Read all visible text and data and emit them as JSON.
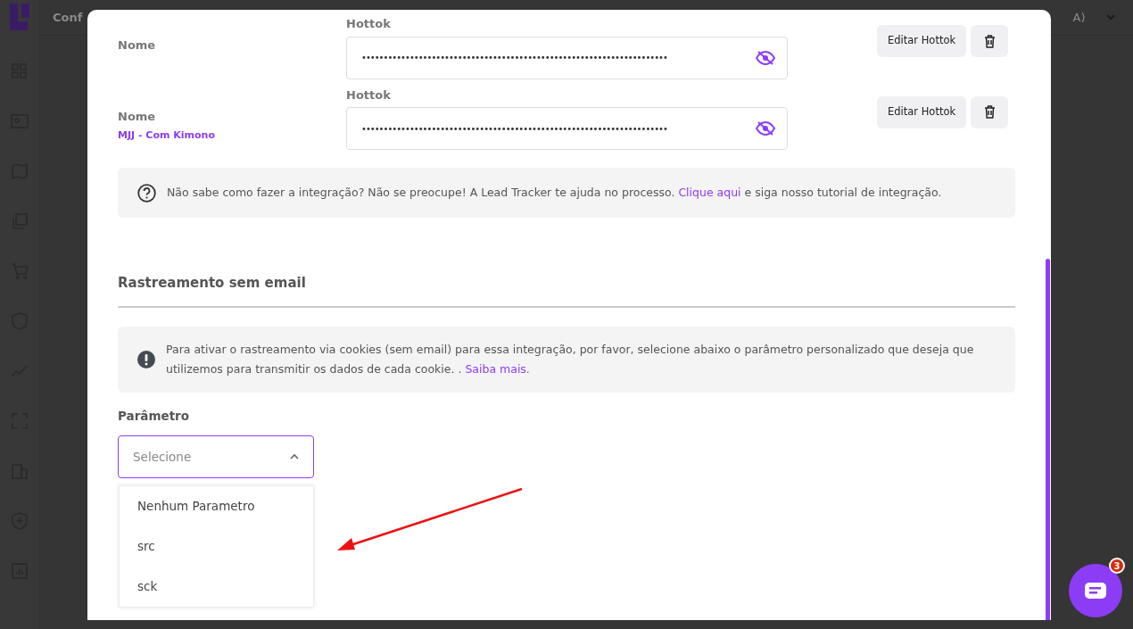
{
  "background": {
    "title": "Conf",
    "account": "A)"
  },
  "hottoks": [
    {
      "name_label": "Nome",
      "field_label": "Hottok",
      "value": "••••••••••••••••••••••••••••••••••••••••••••••••••••••••••••••••••••••",
      "edit_button": "Editar Hottok"
    },
    {
      "name_label": "Nome",
      "name_value": "MJJ - Com Kimono",
      "field_label": "Hottok",
      "value": "••••••••••••••••••••••••••••••••••••••••••••••••••••••••••••••••••••••",
      "edit_button": "Editar Hottok"
    }
  ],
  "help_note": {
    "text": "Não sabe como fazer a integração? Não se preocupe! A Lead Tracker te ajuda no processo. ",
    "link": "Clique aqui",
    "after": " e siga nosso tutorial de integração."
  },
  "section_title": "Rastreamento sem email",
  "warning_note": {
    "text": "Para ativar o rastreamento via cookies (sem email) para essa integração, por favor, selecione abaixo o parâmetro personalizado que deseja que utilizemos para transmitir os dados de cada cookie. . ",
    "link": "Saiba mais."
  },
  "parameter": {
    "label": "Parâmetro",
    "placeholder": "Selecione",
    "expanded": true,
    "options": [
      "Nenhum Parametro",
      "src",
      "sck"
    ]
  },
  "chat": {
    "badge": "3"
  }
}
